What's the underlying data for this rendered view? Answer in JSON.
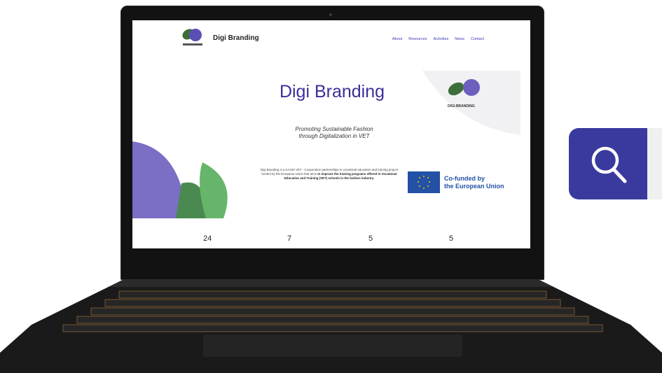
{
  "site": {
    "brand": "Digi Branding",
    "nav": [
      "About",
      "Resources",
      "Activities",
      "News",
      "Contact"
    ],
    "hero_title": "Digi Branding",
    "subtitle_line1": "Promoting Sustainable Fashion",
    "subtitle_line2": "through Digitalization in VET",
    "description_plain": "Digi Branding is a KA220 VET - Cooperation partnerships in vocational education and training project funded by the European Union that aims",
    "description_bold": "to improve the training programs offered in Vocational Education and Training (VET) schools in the fashion industry.",
    "eu_line1": "Co-funded by",
    "eu_line2": "the European Union",
    "card_title": "DIGI-BRANDING",
    "stats": [
      "24",
      "7",
      "5",
      "5"
    ]
  },
  "icons": {
    "search": "search-icon",
    "logo": "leaf-logo-icon"
  },
  "colors": {
    "accent": "#3a3a9e",
    "title": "#3a2f9a",
    "eu_blue": "#2251a6"
  }
}
